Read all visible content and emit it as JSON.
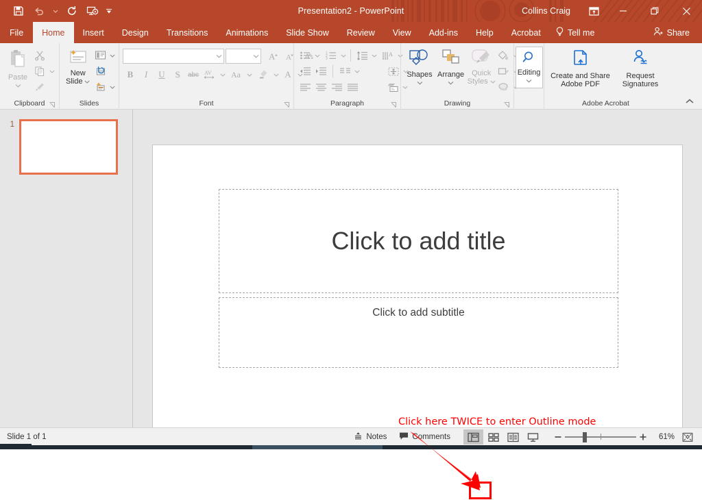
{
  "titlebar": {
    "document_title": "Presentation2",
    "separator": "-",
    "app_name": "PowerPoint",
    "user_name": "Collins Craig",
    "qat": [
      {
        "name": "save",
        "label": "Save"
      },
      {
        "name": "undo",
        "label": "Undo"
      },
      {
        "name": "redo",
        "label": "Redo"
      },
      {
        "name": "start-slideshow",
        "label": "Start From Beginning"
      },
      {
        "name": "customize-qat",
        "label": "Customize Quick Access Toolbar"
      }
    ],
    "window_controls": {
      "ribbon_display": "Ribbon Display Options",
      "minimize": "Minimize",
      "restore": "Restore Down",
      "close": "Close"
    }
  },
  "tabs": [
    {
      "label": "File",
      "active": false
    },
    {
      "label": "Home",
      "active": true
    },
    {
      "label": "Insert",
      "active": false
    },
    {
      "label": "Design",
      "active": false
    },
    {
      "label": "Transitions",
      "active": false
    },
    {
      "label": "Animations",
      "active": false
    },
    {
      "label": "Slide Show",
      "active": false
    },
    {
      "label": "Review",
      "active": false
    },
    {
      "label": "View",
      "active": false
    },
    {
      "label": "Add-ins",
      "active": false
    },
    {
      "label": "Help",
      "active": false
    },
    {
      "label": "Acrobat",
      "active": false
    }
  ],
  "tellme": {
    "label": "Tell me"
  },
  "share": {
    "label": "Share"
  },
  "ribbon": {
    "groups": [
      {
        "label": "Clipboard"
      },
      {
        "label": "Slides"
      },
      {
        "label": "Font"
      },
      {
        "label": "Paragraph"
      },
      {
        "label": "Drawing"
      },
      {
        "label": "Adobe Acrobat"
      }
    ],
    "clipboard": {
      "paste_label": "Paste",
      "cut": "Cut",
      "copy": "Copy",
      "format_painter": "Format Painter"
    },
    "slides": {
      "new_slide_line1": "New",
      "new_slide_line2": "Slide",
      "layout": "Layout",
      "reset": "Reset",
      "section": "Section"
    },
    "font": {
      "font_name_value": "",
      "font_name_placeholder": "",
      "font_size_value": "",
      "font_size_placeholder": "",
      "bold": "B",
      "italic": "I",
      "underline": "U",
      "shadow": "S",
      "strikethrough": "abc",
      "char_spacing": "AV",
      "change_case": "Aa",
      "font_color": "A",
      "clear_formatting": "Clear All Formatting",
      "grow_font": "A",
      "shrink_font": "A"
    },
    "paragraph": {
      "bullets": "Bullets",
      "numbering": "Numbering",
      "line_spacing": "Line Spacing",
      "text_direction": "Text Direction",
      "decrease_indent": "Decrease List Level",
      "increase_indent": "Increase List Level",
      "align_text": "Align Text",
      "columns": "Add or Remove Columns",
      "convert_smartart": "Convert to SmartArt",
      "align_left": "Align Left",
      "align_center": "Center",
      "align_right": "Align Right",
      "justify": "Justify"
    },
    "drawing": {
      "shapes": "Shapes",
      "arrange": "Arrange",
      "quick_styles_line1": "Quick",
      "quick_styles_line2": "Styles",
      "shape_fill": "Shape Fill",
      "shape_outline": "Shape Outline",
      "shape_effects": "Shape Effects"
    },
    "editing": {
      "label": "Editing"
    },
    "acrobat": {
      "create_share_line1": "Create and Share",
      "create_share_line2": "Adobe PDF",
      "request_sig_line1": "Request",
      "request_sig_line2": "Signatures"
    },
    "collapse_label": "Collapse the Ribbon"
  },
  "thumbnails": {
    "slides": [
      {
        "number": "1",
        "selected": true
      }
    ]
  },
  "slide": {
    "title_placeholder": "Click to add title",
    "subtitle_placeholder": "Click to add subtitle"
  },
  "annotation": {
    "text": "Click here TWICE to enter Outline mode",
    "color": "#ff0000",
    "target": "outline-view-button"
  },
  "statusbar": {
    "slide_counter": "Slide 1 of 1",
    "notes_label": "Notes",
    "comments_label": "Comments",
    "views": [
      {
        "name": "normal-view",
        "label": "Normal",
        "active": true
      },
      {
        "name": "slide-sorter-view",
        "label": "Slide Sorter",
        "active": false
      },
      {
        "name": "reading-view",
        "label": "Reading View",
        "active": false
      },
      {
        "name": "slide-show-view",
        "label": "Slide Show",
        "active": false
      }
    ],
    "zoom": {
      "out_label": "Zoom Out",
      "in_label": "Zoom In",
      "percent": "61%",
      "fit_label": "Fit slide to current window"
    }
  }
}
